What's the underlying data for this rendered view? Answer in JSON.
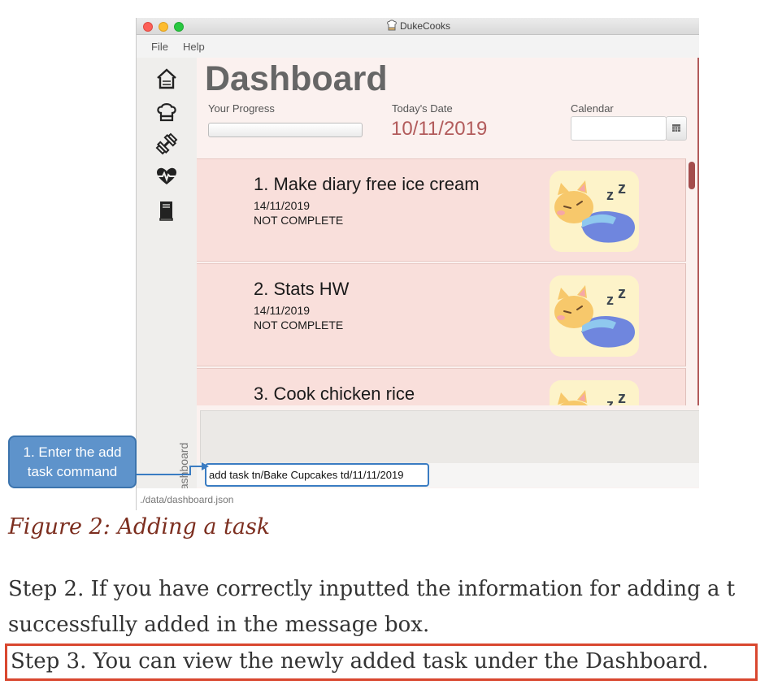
{
  "window": {
    "title": "DukeCooks",
    "menu": [
      "File",
      "Help"
    ]
  },
  "sidebar": {
    "icons": [
      "home-icon",
      "chef-hat-icon",
      "dumbbell-icon",
      "heartbeat-icon",
      "book-icon"
    ],
    "vertical_label": "Dashboard"
  },
  "dashboard": {
    "title": "Dashboard",
    "progress_label": "Your Progress",
    "progress": 0,
    "date_label": "Today's Date",
    "date_value": "10/11/2019",
    "calendar_label": "Calendar",
    "calendar_value": ""
  },
  "tasks": [
    {
      "title": "1.  Make diary free ice cream",
      "date": "14/11/2019",
      "status": "NOT COMPLETE",
      "image": "sleeping-cat-icon"
    },
    {
      "title": "2.  Stats HW",
      "date": "14/11/2019",
      "status": "NOT COMPLETE",
      "image": "sleeping-cat-icon"
    },
    {
      "title": "3.  Cook chicken rice",
      "date": "",
      "status": "",
      "image": "sleeping-cat-icon"
    }
  ],
  "command": {
    "value": "add task tn/Bake Cupcakes td/11/11/2019"
  },
  "status_bar": "./data/dashboard.json",
  "callout": {
    "line1": "1. Enter the add",
    "line2": "task command"
  },
  "doc": {
    "caption": "Figure 2: Adding a task",
    "para1": "Step 2. If you have correctly inputted the information for adding a t",
    "para2": "successfully added in the message box.",
    "para3": "Step 3. You can view the newly added task under the Dashboard."
  },
  "colors": {
    "accent": "#b25b5b",
    "highlight_border": "#d9472f",
    "callout": "#5e93cb"
  }
}
